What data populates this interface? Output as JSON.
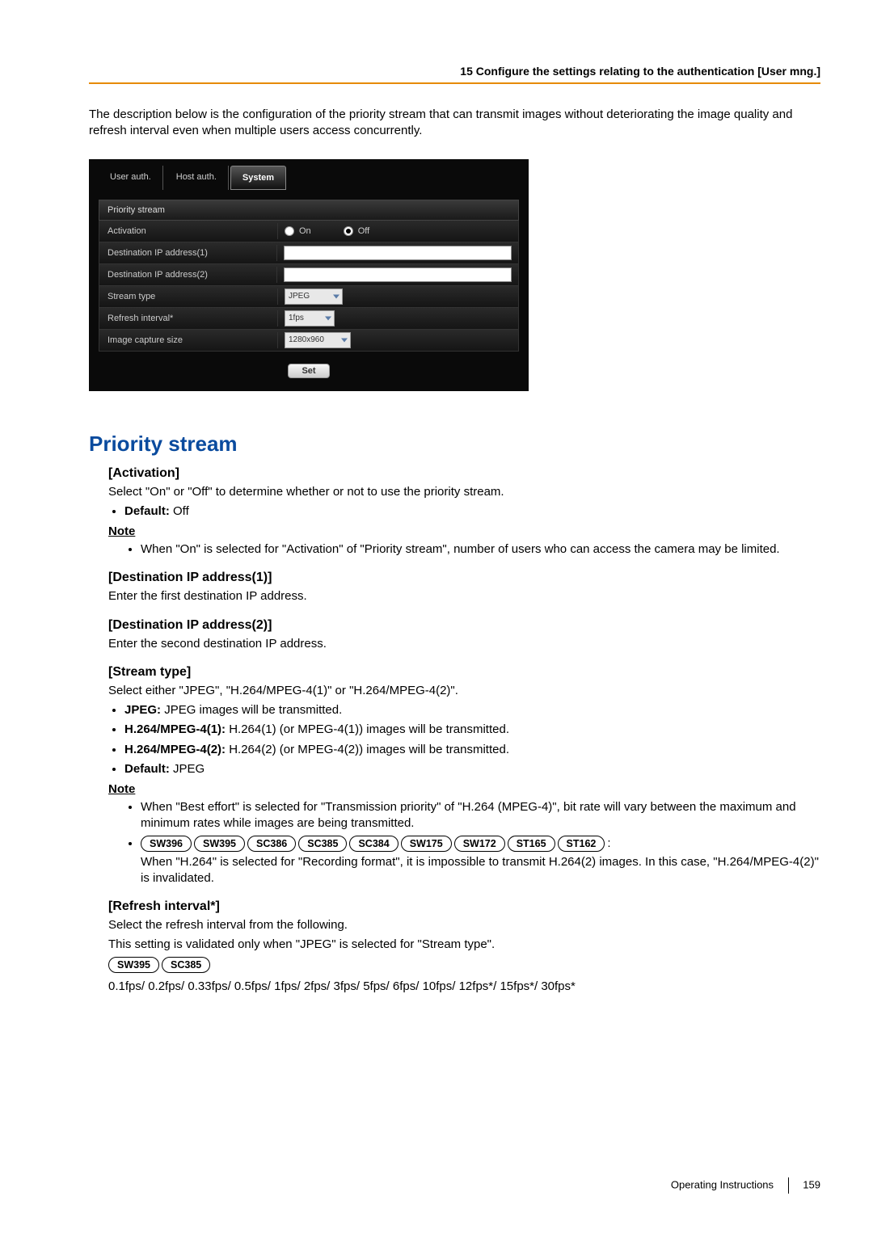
{
  "header": {
    "title": "15 Configure the settings relating to the authentication [User mng.]"
  },
  "intro": "The description below is the configuration of the priority stream that can transmit images without deteriorating the image quality and refresh interval even when multiple users access concurrently.",
  "panel": {
    "tabs": [
      "User auth.",
      "Host auth.",
      "System"
    ],
    "section": "Priority stream",
    "rows": {
      "activation_label": "Activation",
      "activation_on": "On",
      "activation_off": "Off",
      "dest1_label": "Destination IP address(1)",
      "dest2_label": "Destination IP address(2)",
      "stream_label": "Stream type",
      "stream_value": "JPEG",
      "refresh_label": "Refresh interval*",
      "refresh_value": "1fps",
      "capture_label": "Image capture size",
      "capture_value": "1280x960"
    },
    "set_button": "Set"
  },
  "content": {
    "title": "Priority stream",
    "activation": {
      "heading": "[Activation]",
      "desc": "Select \"On\" or \"Off\" to determine whether or not to use the priority stream.",
      "default_label": "Default:",
      "default_value": "Off",
      "note_label": "Note",
      "note_text": "When \"On\" is selected for \"Activation\" of \"Priority stream\", number of users who can access the camera may be limited."
    },
    "dest1": {
      "heading": "[Destination IP address(1)]",
      "desc": "Enter the first destination IP address."
    },
    "dest2": {
      "heading": "[Destination IP address(2)]",
      "desc": "Enter the second destination IP address."
    },
    "stream": {
      "heading": "[Stream type]",
      "desc": "Select either \"JPEG\", \"H.264/MPEG-4(1)\" or \"H.264/MPEG-4(2)\".",
      "jpeg_label": "JPEG:",
      "jpeg_text": "JPEG images will be transmitted.",
      "h264_1_label": "H.264/MPEG-4(1):",
      "h264_1_text": "H.264(1) (or MPEG-4(1)) images will be transmitted.",
      "h264_2_label": "H.264/MPEG-4(2):",
      "h264_2_text": "H.264(2) (or MPEG-4(2)) images will be transmitted.",
      "default_label": "Default:",
      "default_value": "JPEG",
      "note_label": "Note",
      "note1": "When \"Best effort\" is selected for \"Transmission priority\" of \"H.264 (MPEG-4)\", bit rate will vary between the maximum and minimum rates while images are being transmitted.",
      "models1": [
        "SW396",
        "SW395",
        "SC386",
        "SC385",
        "SC384",
        "SW175",
        "SW172",
        "ST165",
        "ST162"
      ],
      "note2": "When \"H.264\" is selected for \"Recording format\", it is impossible to transmit H.264(2) images. In this case, \"H.264/MPEG-4(2)\" is invalidated."
    },
    "refresh": {
      "heading": "[Refresh interval*]",
      "line1": "Select the refresh interval from the following.",
      "line2": "This setting is validated only when \"JPEG\" is selected for \"Stream type\".",
      "models": [
        "SW395",
        "SC385"
      ],
      "values": "0.1fps/ 0.2fps/ 0.33fps/ 0.5fps/ 1fps/ 2fps/ 3fps/ 5fps/ 6fps/ 10fps/ 12fps*/ 15fps*/ 30fps*"
    }
  },
  "footer": {
    "label": "Operating Instructions",
    "page": "159"
  }
}
